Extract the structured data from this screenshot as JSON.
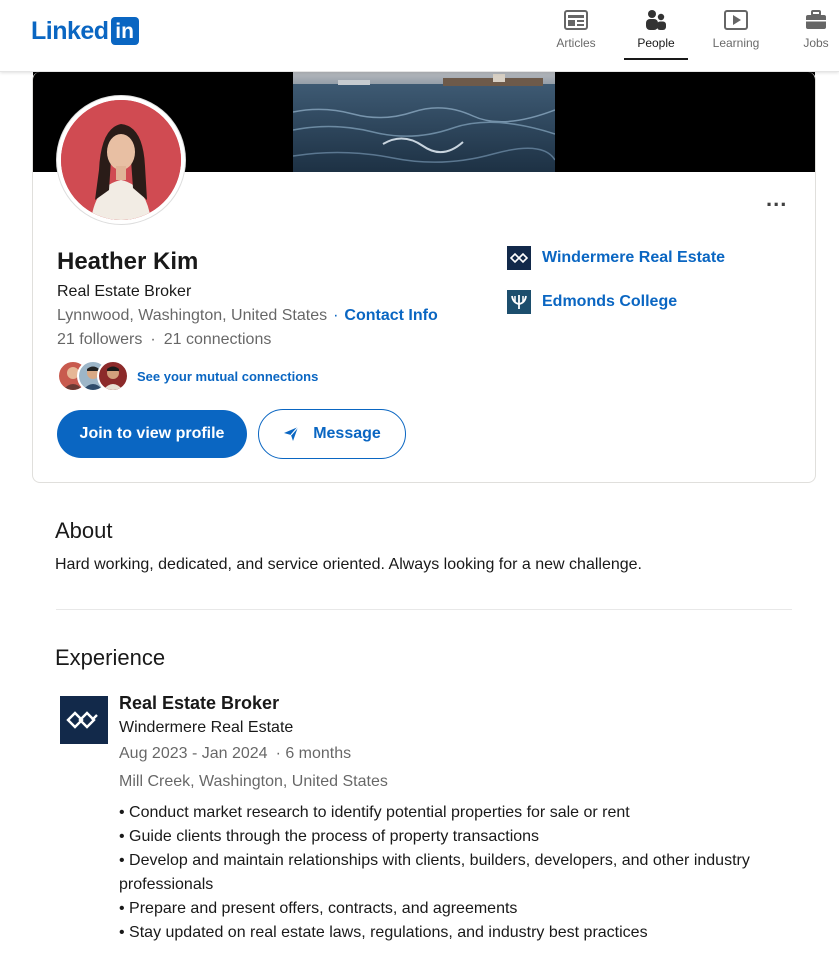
{
  "header": {
    "logo_word": "Linked",
    "logo_box": "in",
    "nav": [
      {
        "label": "Articles",
        "icon": "articles-icon"
      },
      {
        "label": "People",
        "icon": "people-icon",
        "active": true
      },
      {
        "label": "Learning",
        "icon": "learning-icon"
      },
      {
        "label": "Jobs",
        "icon": "jobs-icon"
      }
    ]
  },
  "profile": {
    "name": "Heather Kim",
    "headline": "Real Estate Broker",
    "location": "Lynnwood, Washington, United States",
    "contact_info": "Contact Info",
    "followers": "21 followers",
    "connections": "21 connections",
    "mutual_link": "See your mutual connections",
    "join_button": "Join to view profile",
    "message_button": "Message",
    "more_label": "...",
    "orgs": [
      {
        "name": "Windermere Real Estate",
        "icon": "windermere-logo"
      },
      {
        "name": "Edmonds College",
        "icon": "edmonds-college-logo"
      }
    ]
  },
  "about": {
    "title": "About",
    "text": "Hard working, dedicated, and service oriented. Always looking for a new challenge."
  },
  "experience": {
    "title": "Experience",
    "items": [
      {
        "role": "Real Estate Broker",
        "company": "Windermere Real Estate",
        "dates": "Aug 2023 - Jan 2024",
        "duration": "· 6 months",
        "location": "Mill Creek, Washington, United States",
        "bullets": [
          "• Conduct market research to identify potential properties for sale or rent",
          "• Guide clients through the process of property transactions",
          "• Develop and maintain relationships with clients, builders, developers, and other industry professionals",
          "• Prepare and present offers, contracts, and agreements",
          "• Stay updated on real estate laws, regulations, and industry best practices"
        ]
      }
    ]
  },
  "colors": {
    "brand": "#0a66c2",
    "windermere_navy": "#12294a",
    "edmonds_teal": "#1c4e6d"
  }
}
